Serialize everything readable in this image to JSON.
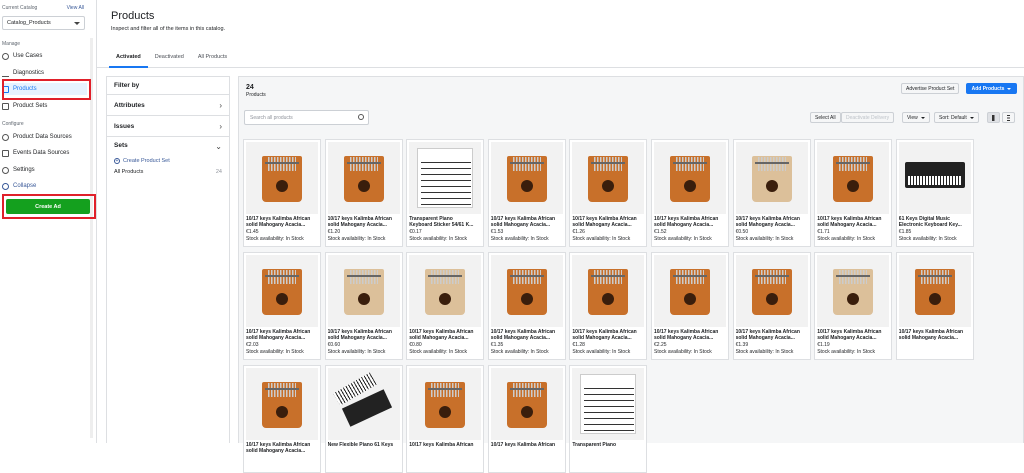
{
  "sidebar": {
    "current_catalog_label": "Current Catalog",
    "view_all": "View All",
    "catalog_selected": "Catalog_Products",
    "manage_label": "Manage",
    "manage_items": [
      "Use Cases",
      "Diagnostics",
      "Products",
      "Product Sets"
    ],
    "configure_label": "Configure",
    "configure_items": [
      "Product Data Sources",
      "Events Data Sources",
      "Settings",
      "Collapse"
    ],
    "create_ad": "Create Ad"
  },
  "header": {
    "title": "Products",
    "subtitle": "Inspect and filter all of the items in this catalog."
  },
  "tabs": [
    "Activated",
    "Deactivated",
    "All Products"
  ],
  "filter": {
    "title": "Filter by",
    "attributes": "Attributes",
    "issues": "Issues",
    "sets": "Sets",
    "create_set": "Create Product Set",
    "all_products": "All Products",
    "all_products_count": "24"
  },
  "toolbar": {
    "count": "24",
    "count_label": "Products",
    "advertise": "Advertise Product Set",
    "add_products": "Add Products",
    "search_placeholder": "Search all products",
    "select_all": "Select All",
    "deactivate": "Deactivate Delivery",
    "view": "View",
    "sort": "Sort: Default"
  },
  "products": [
    {
      "t1": "10/17 keys Kalimba African",
      "t2": "solid Mahogany Acacia...",
      "price": "€1.45",
      "stock": "Stock availability: In Stock",
      "img": "kalimba-dark"
    },
    {
      "t1": "10/17 keys Kalimba African",
      "t2": "solid Mahogany Acacia...",
      "price": "€1.20",
      "stock": "Stock availability: In Stock",
      "img": "kalimba-dark"
    },
    {
      "t1": "Transparent Piano",
      "t2": "Keyboard Sticker 54/61 K...",
      "price": "€0.17",
      "stock": "Stock availability: In Stock",
      "img": "sticker"
    },
    {
      "t1": "10/17 keys Kalimba African",
      "t2": "solid Mahogany Acacia...",
      "price": "€1.53",
      "stock": "Stock availability: In Stock",
      "img": "kalimba-dark"
    },
    {
      "t1": "10/17 keys Kalimba African",
      "t2": "solid Mahogany Acacia...",
      "price": "€1.26",
      "stock": "Stock availability: In Stock",
      "img": "kalimba-dark"
    },
    {
      "t1": "10/17 keys Kalimba African",
      "t2": "solid Mahogany Acacia...",
      "price": "€1.52",
      "stock": "Stock availability: In Stock",
      "img": "kalimba-dark"
    },
    {
      "t1": "10/17 keys Kalimba African",
      "t2": "solid Mahogany Acacia...",
      "price": "€0.50",
      "stock": "Stock availability: In Stock",
      "img": "kalimba-light"
    },
    {
      "t1": "10/17 keys Kalimba African",
      "t2": "solid Mahogany Acacia...",
      "price": "€1.71",
      "stock": "Stock availability: In Stock",
      "img": "kalimba-dark"
    },
    {
      "t1": "61 Keys Digital Music",
      "t2": "Electronic Keyboard Key...",
      "price": "€1.85",
      "stock": "Stock availability: In Stock",
      "img": "piano"
    },
    {
      "t1": "10/17 keys Kalimba African",
      "t2": "solid Mahogany Acacia...",
      "price": "€2.03",
      "stock": "Stock availability: In Stock",
      "img": "kalimba-dark"
    },
    {
      "t1": "10/17 keys Kalimba African",
      "t2": "solid Mahogany Acacia...",
      "price": "€0.60",
      "stock": "Stock availability: In Stock",
      "img": "kalimba-light"
    },
    {
      "t1": "10/17 keys Kalimba African",
      "t2": "solid Mahogany Acacia...",
      "price": "€0.80",
      "stock": "Stock availability: In Stock",
      "img": "kalimba-light"
    },
    {
      "t1": "10/17 keys Kalimba African",
      "t2": "solid Mahogany Acacia...",
      "price": "€1.35",
      "stock": "Stock availability: In Stock",
      "img": "kalimba-dark"
    },
    {
      "t1": "10/17 keys Kalimba African",
      "t2": "solid Mahogany Acacia...",
      "price": "€1.28",
      "stock": "Stock availability: In Stock",
      "img": "kalimba-dark"
    },
    {
      "t1": "10/17 keys Kalimba African",
      "t2": "solid Mahogany Acacia...",
      "price": "€2.25",
      "stock": "Stock availability: In Stock",
      "img": "kalimba-dark"
    },
    {
      "t1": "10/17 keys Kalimba African",
      "t2": "solid Mahogany Acacia...",
      "price": "€1.39",
      "stock": "Stock availability: In Stock",
      "img": "kalimba-dark"
    },
    {
      "t1": "10/17 keys Kalimba African",
      "t2": "solid Mahogany Acacia...",
      "price": "€1.19",
      "stock": "Stock availability: In Stock",
      "img": "kalimba-light"
    },
    {
      "t1": "10/17 keys Kalimba African",
      "t2": "solid Mahogany Acacia...",
      "price": "",
      "stock": "",
      "img": "kalimba-dark"
    },
    {
      "t1": "10/17 keys Kalimba African",
      "t2": "solid Mahogany Acacia...",
      "price": "",
      "stock": "",
      "img": "kalimba-dark"
    },
    {
      "t1": "New Flexible Piano 61 Keys",
      "t2": "",
      "price": "",
      "stock": "",
      "img": "roll"
    },
    {
      "t1": "10/17 keys Kalimba African",
      "t2": "",
      "price": "",
      "stock": "",
      "img": "kalimba-dark"
    },
    {
      "t1": "10/17 keys Kalimba African",
      "t2": "",
      "price": "",
      "stock": "",
      "img": "kalimba-dark"
    },
    {
      "t1": "Transparent Piano",
      "t2": "",
      "price": "",
      "stock": "",
      "img": "sticker"
    }
  ],
  "colors": {
    "accent": "#1877f2",
    "create_ad": "#14a01e",
    "highlight": "#e0202a"
  }
}
